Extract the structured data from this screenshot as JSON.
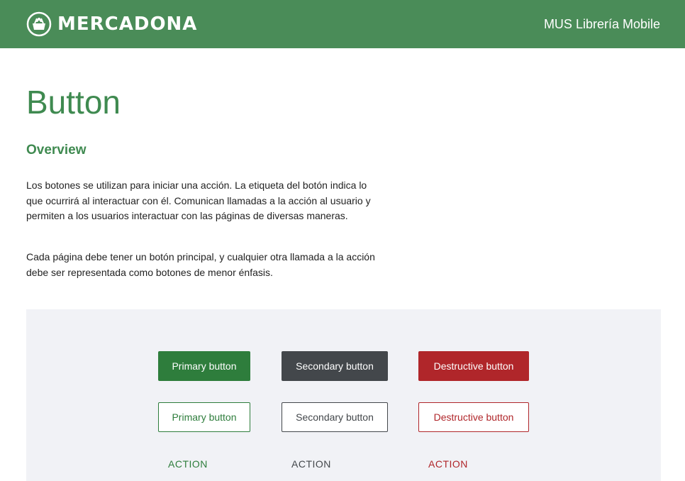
{
  "header": {
    "brand": "MERCADONA",
    "logo_icon": "shopping-basket-icon",
    "app_title": "MUS Librería Mobile",
    "colors": {
      "background": "#4a8c58",
      "text": "#ffffff"
    }
  },
  "main": {
    "title": "Button",
    "overview_heading": "Overview",
    "paragraphs": [
      "Los botones se utilizan para iniciar una acción. La etiqueta del botón indica lo que ocurrirá al interactuar con él. Comunican llamadas a la acción al usuario y permiten a los usuarios interactuar con las páginas de diversas maneras.",
      "Cada página debe tener un botón principal, y cualquier otra llamada a la acción debe ser representada como botones de menor énfasis."
    ],
    "accent_color": "#3f8a50"
  },
  "demo": {
    "filled": {
      "primary": "Primary button",
      "secondary": "Secondary button",
      "destructive": "Destructive button"
    },
    "outlined": {
      "primary": "Primary button",
      "secondary": "Secondary button",
      "destructive": "Destructive button"
    },
    "text": {
      "primary": "ACTION",
      "secondary": "ACTION",
      "destructive": "ACTION"
    },
    "colors": {
      "primary": "#2e7d3c",
      "secondary": "#43474b",
      "destructive": "#b0262a",
      "panel_background": "#f1f2f6"
    }
  }
}
